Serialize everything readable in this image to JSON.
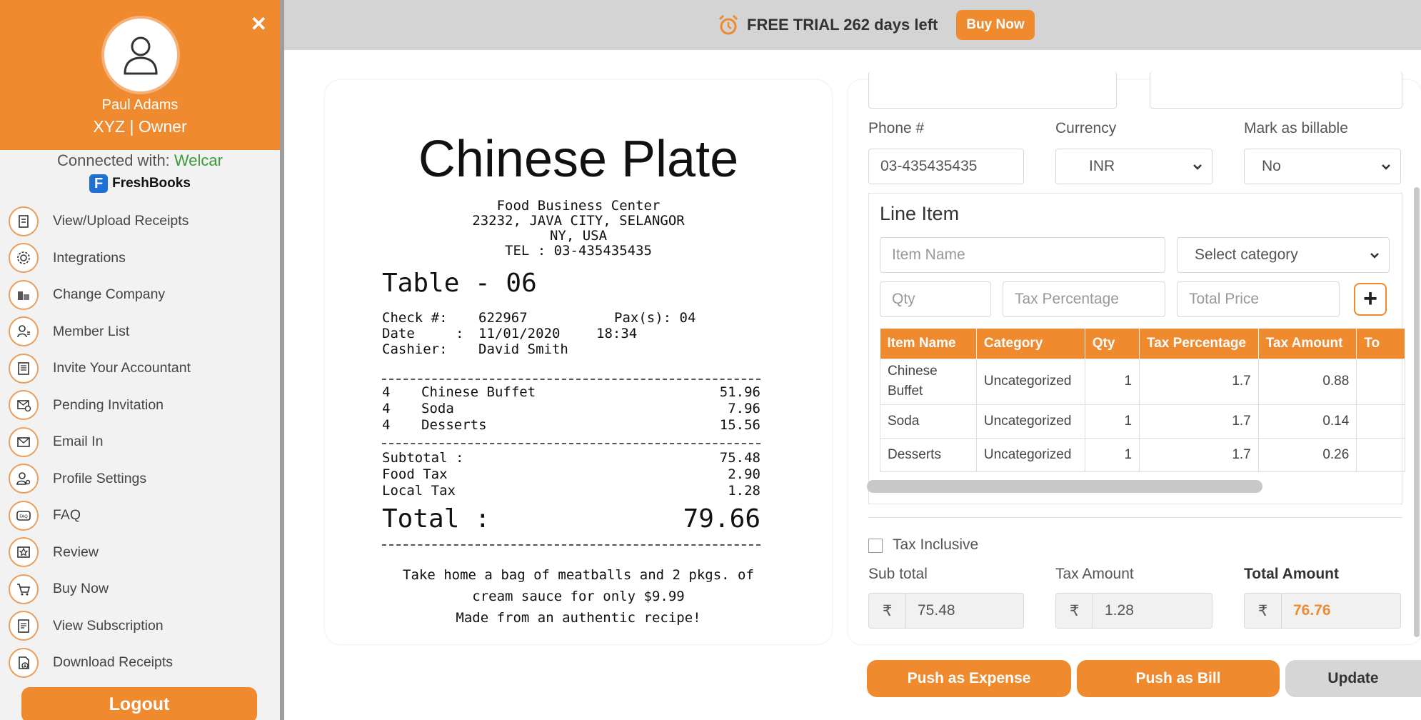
{
  "sidebar": {
    "user_name": "Paul Adams",
    "user_role": "XYZ | Owner",
    "connected_prefix": "Connected with: ",
    "connected_name": "Welcar",
    "integration_name": "FreshBooks",
    "items": [
      {
        "label": "View/Upload Receipts",
        "icon": "receipt-upload-icon"
      },
      {
        "label": "Integrations",
        "icon": "gear-icon"
      },
      {
        "label": "Change Company",
        "icon": "buildings-icon"
      },
      {
        "label": "Member List",
        "icon": "user-list-icon"
      },
      {
        "label": "Invite Your Accountant",
        "icon": "invite-accountant-icon"
      },
      {
        "label": "Pending Invitation",
        "icon": "pending-mail-icon"
      },
      {
        "label": "Email In",
        "icon": "envelope-icon"
      },
      {
        "label": "Profile Settings",
        "icon": "user-settings-icon"
      },
      {
        "label": "FAQ",
        "icon": "faq-icon"
      },
      {
        "label": "Review",
        "icon": "review-star-icon"
      },
      {
        "label": "Buy Now",
        "icon": "shopping-cart-icon"
      },
      {
        "label": "View Subscription",
        "icon": "subscription-doc-icon"
      },
      {
        "label": "Download Receipts",
        "icon": "download-doc-icon"
      }
    ],
    "logout_label": "Logout"
  },
  "topbar": {
    "trial_text": "FREE TRIAL 262 days left",
    "buy_label": "Buy Now"
  },
  "receipt": {
    "title": "Chinese Plate",
    "address": [
      "Food Business Center",
      "23232, JAVA CITY, SELANGOR",
      "NY, USA",
      "TEL : 03-435435435"
    ],
    "table": "Table - 06",
    "check_label": "Check #:",
    "check_value": "622967",
    "pax": "Pax(s): 04",
    "date_label": "Date     :",
    "date_value": "11/01/2020",
    "time_value": "18:34",
    "cashier_label": "Cashier:",
    "cashier_value": "David Smith",
    "items": [
      {
        "qty": "4",
        "name": "Chinese Buffet",
        "amount": "51.96"
      },
      {
        "qty": "4",
        "name": "Soda",
        "amount": "7.96"
      },
      {
        "qty": "4",
        "name": "Desserts",
        "amount": "15.56"
      }
    ],
    "subtotal_label": "Subtotal :",
    "subtotal": "75.48",
    "food_tax_label": "Food Tax",
    "food_tax": "2.90",
    "local_tax_label": "Local Tax",
    "local_tax": "1.28",
    "total_label": "Total :",
    "total": "79.66",
    "footer": [
      "Take home a bag of meatballs and 2 pkgs. of",
      "cream sauce for only $9.99",
      "Made from an authentic recipe!"
    ]
  },
  "form": {
    "phone_label": "Phone #",
    "phone_value": "03-435435435",
    "currency_label": "Currency",
    "currency_value": "INR",
    "billable_label": "Mark as billable",
    "billable_value": "No",
    "line_item_title": "Line Item",
    "item_name_ph": "Item Name",
    "category_ph": "Select category",
    "qty_ph": "Qty",
    "tax_pct_ph": "Tax Percentage",
    "total_price_ph": "Total Price",
    "table_headers": [
      "Item Name",
      "Category",
      "Qty",
      "Tax Percentage",
      "Tax Amount",
      "To"
    ],
    "rows": [
      {
        "name": "Chinese Buffet",
        "category": "Uncategorized",
        "qty": "1",
        "tax_pct": "1.7",
        "tax_amt": "0.88"
      },
      {
        "name": "Soda",
        "category": "Uncategorized",
        "qty": "1",
        "tax_pct": "1.7",
        "tax_amt": "0.14"
      },
      {
        "name": "Desserts",
        "category": "Uncategorized",
        "qty": "1",
        "tax_pct": "1.7",
        "tax_amt": "0.26"
      }
    ],
    "tax_inclusive_label": "Tax Inclusive",
    "subtotal_label": "Sub total",
    "subtotal_value": "75.48",
    "tax_amount_label": "Tax Amount",
    "tax_amount_value": "1.28",
    "total_amount_label": "Total Amount",
    "total_amount_value": "76.76",
    "currency_symbol": "₹"
  },
  "actions": {
    "push_expense": "Push as Expense",
    "push_bill": "Push as Bill",
    "update": "Update"
  },
  "colors": {
    "accent": "#ef8a2f",
    "connected": "#3a9a3a",
    "freshbooks": "#1f70d6"
  }
}
